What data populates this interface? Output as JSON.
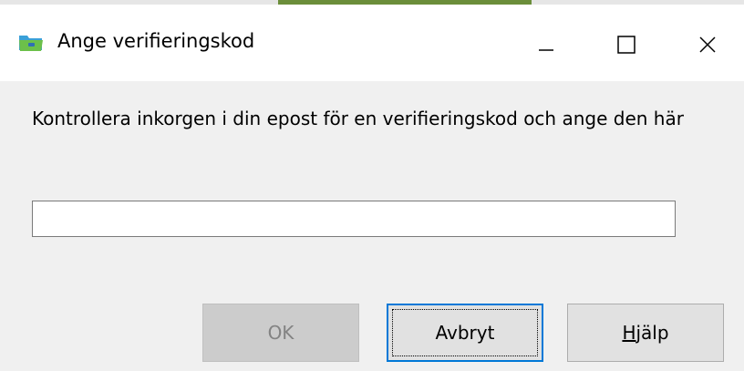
{
  "window": {
    "title": "Ange verifieringskod",
    "app_icon": "folder-app-icon",
    "controls": {
      "minimize_icon": "minimize-icon",
      "maximize_icon": "maximize-icon",
      "close_icon": "close-icon"
    }
  },
  "dialog": {
    "message": "Kontrollera inkorgen i din epost för en verifieringskod och ange den här",
    "code_input": {
      "value": "",
      "placeholder": ""
    },
    "buttons": {
      "ok_label": "OK",
      "cancel_label": "Avbryt",
      "help_label_first": "H",
      "help_label_rest": "jälp"
    }
  },
  "colors": {
    "title_bar": "#ffffff",
    "dialog_bg": "#f0f0f0",
    "focus_border": "#0078d7",
    "disabled_button": "#cccccc",
    "accent_strip": "#6b8e3a"
  }
}
